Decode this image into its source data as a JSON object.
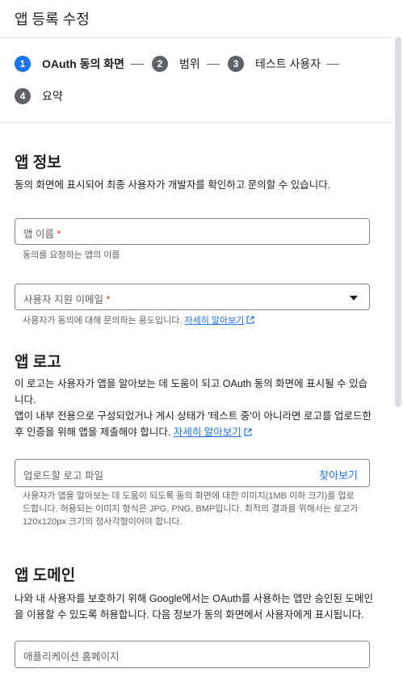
{
  "header": {
    "title": "앱 등록 수정"
  },
  "steps": [
    {
      "number": "1",
      "label": "OAuth 동의 화면"
    },
    {
      "number": "2",
      "label": "범위"
    },
    {
      "number": "3",
      "label": "테스트 사용자"
    },
    {
      "number": "4",
      "label": "요약"
    }
  ],
  "app_info": {
    "heading": "앱 정보",
    "description": "동의 화면에 표시되어 최종 사용자가 개발자를 확인하고 문의할 수 있습니다.",
    "app_name": {
      "placeholder": "앱 이름",
      "required_mark": "*",
      "hint": "동의를 요청하는 앱의 이름"
    },
    "support_email": {
      "placeholder": "사용자 지원 이메일",
      "required_mark": "*",
      "hint": "사용자가 동의에 대해 문의하는 용도입니다.",
      "link": "자세히 알아보기"
    }
  },
  "app_logo": {
    "heading": "앱 로고",
    "description1": "이 로고는 사용자가 앱을 알아보는 데 도움이 되고 OAuth 동의 화면에 표시될 수 있습니다.",
    "description2": "앱이 내부 전용으로 구성되었거나 게시 상태가 '테스트 중'이 아니라면 로고를 업로드한 후 인증을 위해 앱을 제출해야 합니다.",
    "link": "자세히 알아보기",
    "upload_placeholder": "업로드할 로고 파일",
    "browse_label": "찾아보기",
    "hint": "사용자가 앱을 알아보는 데 도움이 되도록 동의 화면에 대한 이미지(1MB 이하 크기)를 업로드합니다. 허용되는 이미지 형식은 JPG, PNG, BMP입니다. 최적의 결과를 위해서는 로고가 120x120px 크기의 정사각형이어야 합니다."
  },
  "app_domain": {
    "heading": "앱 도메인",
    "description": "나와 내 사용자를 보호하기 위해 Google에서는 OAuth를 사용하는 앱만 승인된 도메인을 이용할 수 있도록 허용합니다. 다음 정보가 동의 화면에서 사용자에게 표시됩니다.",
    "homepage_placeholder": "애플리케이션 홈페이지"
  }
}
